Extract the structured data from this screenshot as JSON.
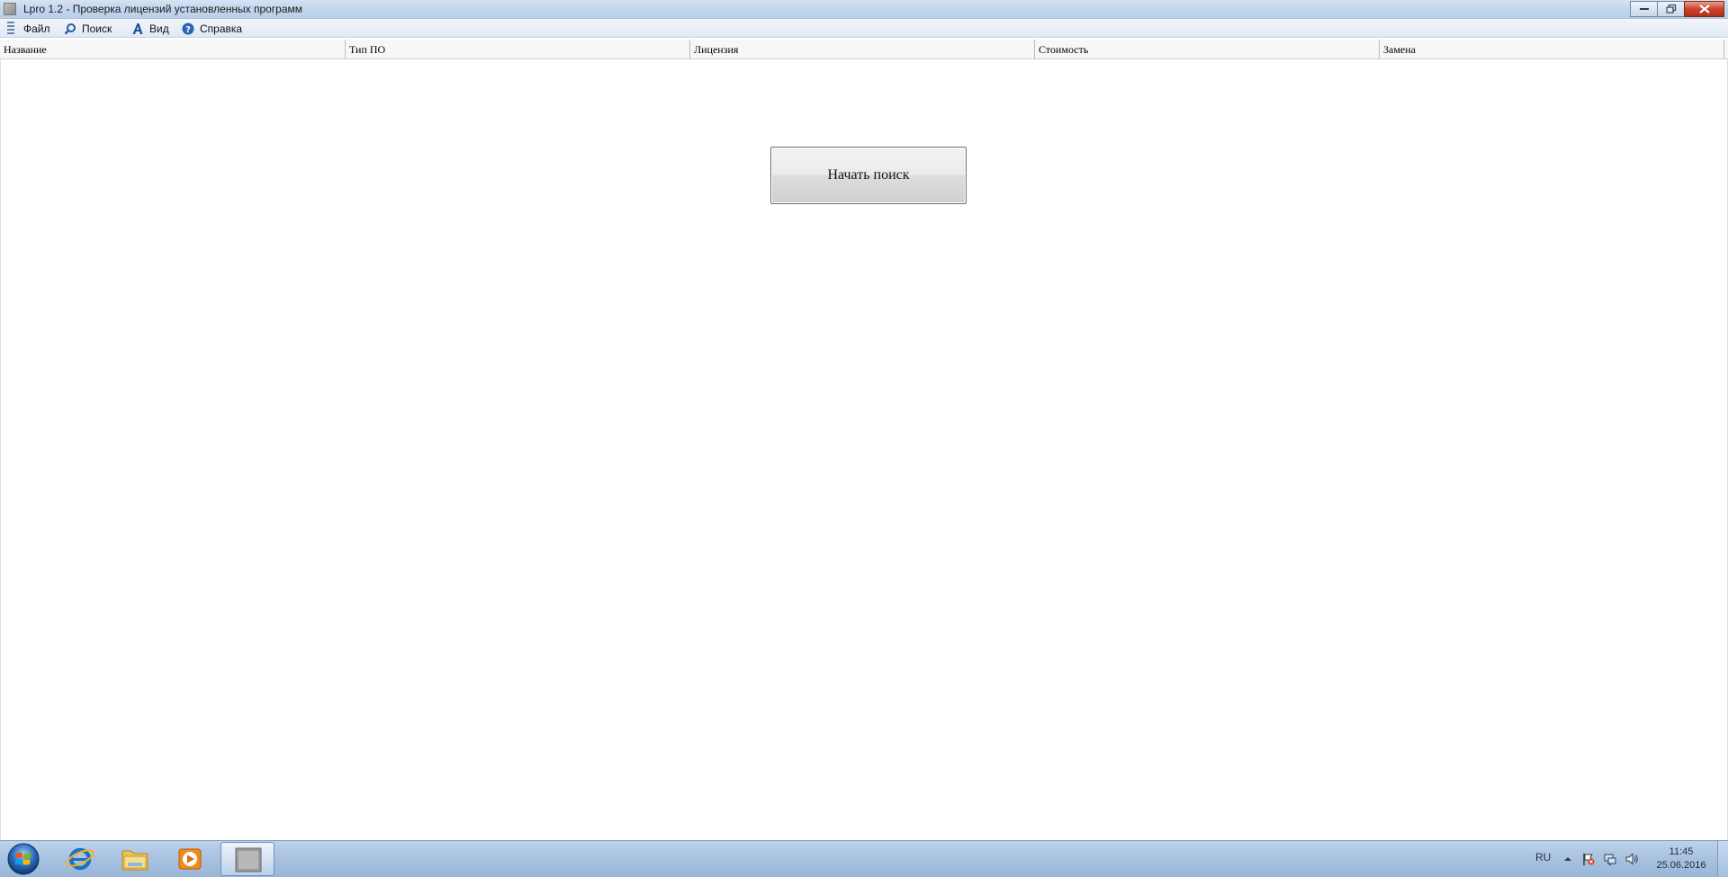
{
  "window": {
    "title": "Lpro 1.2 - Проверка лицензий установленных программ"
  },
  "menu": {
    "items": [
      {
        "label": "Файл",
        "icon": "file-icon"
      },
      {
        "label": "Поиск",
        "icon": "search-icon"
      },
      {
        "label": "Вид",
        "icon": "font-icon"
      },
      {
        "label": "Справка",
        "icon": "help-icon"
      }
    ]
  },
  "table": {
    "columns": [
      "Название",
      "Тип ПО",
      "Лицензия",
      "Стоимость",
      "Замена"
    ],
    "rows": []
  },
  "main": {
    "start_button_label": "Начать поиск"
  },
  "taskbar": {
    "pinned": [
      "windows-start-orb",
      "internet-explorer-icon",
      "file-explorer-icon",
      "media-player-icon",
      "lpro-app-icon"
    ],
    "language": "RU",
    "time": "11:45",
    "date": "25.06.2016"
  },
  "colors": {
    "titlebar": "#c3d6ee",
    "taskbar": "#a9c3e0",
    "close_button": "#c7442b"
  }
}
